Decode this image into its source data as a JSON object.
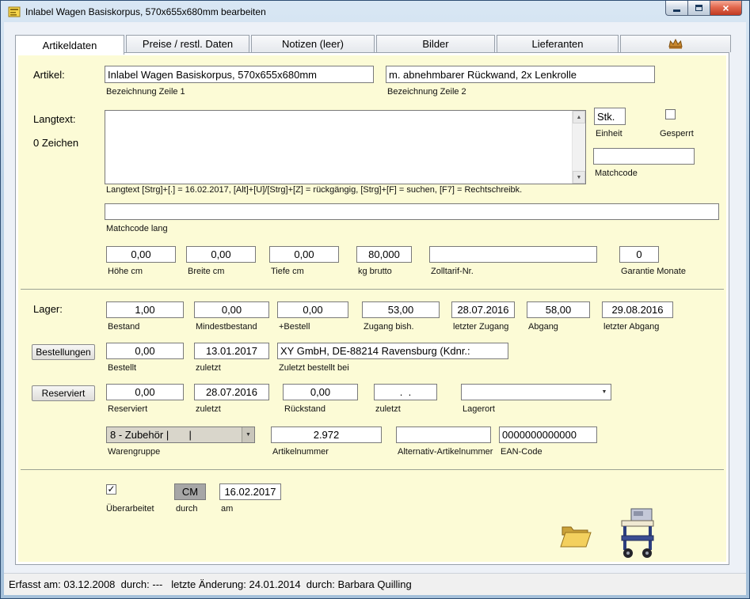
{
  "window": {
    "title": "Inlabel Wagen Basiskorpus, 570x655x680mm bearbeiten"
  },
  "icons": {
    "close": "×",
    "check": "✓",
    "combo_arrow": "▼",
    "scroll_up": "▲",
    "scroll_down": "▼"
  },
  "tabs": [
    {
      "label": "Artikeldaten"
    },
    {
      "label": "Preise / restl. Daten"
    },
    {
      "label": "Notizen (leer)"
    },
    {
      "label": "Bilder"
    },
    {
      "label": "Lieferanten"
    },
    {
      "label": ""
    }
  ],
  "artikel": {
    "label": "Artikel:",
    "zeile1": {
      "value": "Inlabel Wagen Basiskorpus, 570x655x680mm",
      "caption": "Bezeichnung Zeile 1"
    },
    "zeile2": {
      "value": "m. abnehmbarer Rückwand, 2x Lenkrolle",
      "caption": "Bezeichnung Zeile 2"
    }
  },
  "langtext": {
    "label": "Langtext:",
    "zeichen": "0 Zeichen",
    "value": "",
    "hint": "Langtext [Strg]+[.] = 16.02.2017, [Alt]+[U]/[Strg]+[Z] = rückgängig, [Strg]+[F] = suchen, [F7] = Rechtschreibk.",
    "einheit": {
      "value": "Stk.",
      "caption": "Einheit"
    },
    "gesperrt": {
      "caption": "Gesperrt",
      "checked": false
    },
    "matchcode": {
      "value": "",
      "caption": "Matchcode"
    },
    "matchcode_lang": {
      "value": "",
      "caption": "Matchcode lang"
    }
  },
  "masse": [
    {
      "value": "0,00",
      "caption": "Höhe cm"
    },
    {
      "value": "0,00",
      "caption": "Breite cm"
    },
    {
      "value": "0,00",
      "caption": "Tiefe cm"
    },
    {
      "value": "80,000",
      "caption": "kg brutto"
    },
    {
      "value": "",
      "caption": "Zolltarif-Nr."
    },
    {
      "value": "0",
      "caption": "Garantie Monate"
    }
  ],
  "lager": {
    "label": "Lager:",
    "fields": [
      {
        "value": "1,00",
        "caption": "Bestand"
      },
      {
        "value": "0,00",
        "caption": "Mindestbestand"
      },
      {
        "value": "0,00",
        "caption": "+Bestell"
      },
      {
        "value": "53,00",
        "caption": "Zugang bish."
      },
      {
        "value": "28.07.2016",
        "caption": "letzter Zugang"
      },
      {
        "value": "58,00",
        "caption": "Abgang"
      },
      {
        "value": "29.08.2016",
        "caption": "letzter Abgang"
      }
    ]
  },
  "bestellungen": {
    "button": "Bestellungen",
    "fields": [
      {
        "value": "0,00",
        "caption": "Bestellt"
      },
      {
        "value": "13.01.2017",
        "caption": "zuletzt"
      },
      {
        "value": "XY GmbH, DE-88214 Ravensburg (Kdnr.:",
        "caption": "Zuletzt bestellt bei"
      }
    ]
  },
  "reserviert": {
    "button": "Reserviert",
    "fields": [
      {
        "value": "0,00",
        "caption": "Reserviert"
      },
      {
        "value": "28.07.2016",
        "caption": "zuletzt"
      },
      {
        "value": "0,00",
        "caption": "Rückstand"
      },
      {
        "value": " .  . ",
        "caption": "zuletzt"
      }
    ],
    "lagerort": {
      "value": "",
      "caption": "Lagerort"
    }
  },
  "gruppe": {
    "warengruppe": {
      "value": "8 - Zubehör |       |",
      "caption": "Warengruppe"
    },
    "artikelnummer": {
      "value": "2.972",
      "caption": "Artikelnummer"
    },
    "alternativ": {
      "value": "",
      "caption": "Alternativ-Artikelnummer"
    },
    "ean": {
      "value": "0000000000000",
      "caption": "EAN-Code"
    }
  },
  "footer": {
    "ueberarbeitet": {
      "caption": "Überarbeitet",
      "checked": true
    },
    "durch": {
      "value": "CM",
      "caption": "durch"
    },
    "am": {
      "value": "16.02.2017",
      "caption": "am"
    }
  },
  "statusbar": {
    "text": "Erfasst am: 03.12.2008  durch: ---   letzte Änderung: 24.01.2014  durch: Barbara Quilling"
  }
}
